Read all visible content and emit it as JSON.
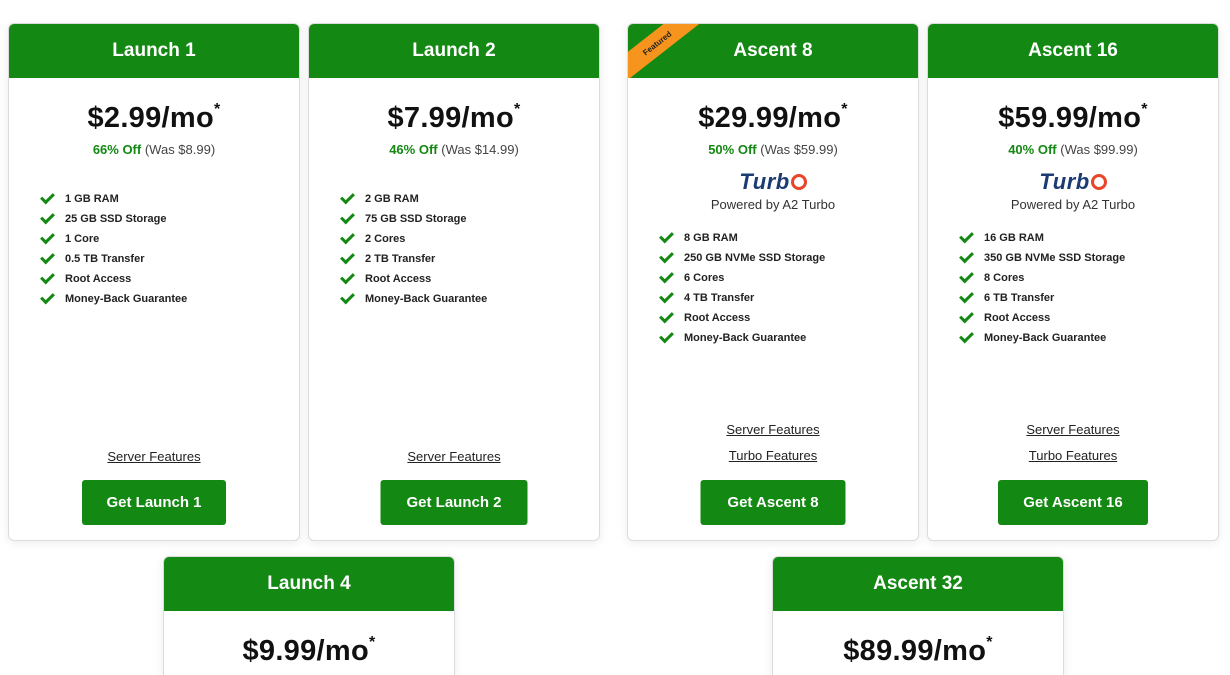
{
  "plans": [
    {
      "name": "Launch 1",
      "price": "$2.99/mo",
      "asterisk": "*",
      "off": "66% Off",
      "was": "(Was $8.99)",
      "features": [
        "1 GB RAM",
        "25 GB SSD Storage",
        "1 Core",
        "0.5 TB Transfer",
        "Root Access",
        "Money-Back Guarantee"
      ],
      "server_features": "Server Features",
      "cta": "Get Launch 1"
    },
    {
      "name": "Launch 2",
      "price": "$7.99/mo",
      "asterisk": "*",
      "off": "46% Off",
      "was": "(Was $14.99)",
      "features": [
        "2 GB RAM",
        "75 GB SSD Storage",
        "2 Cores",
        "2 TB Transfer",
        "Root Access",
        "Money-Back Guarantee"
      ],
      "server_features": "Server Features",
      "cta": "Get Launch 2"
    },
    {
      "name": "Ascent 8",
      "ribbon": "Featured",
      "price": "$29.99/mo",
      "asterisk": "*",
      "off": "50% Off",
      "was": "(Was $59.99)",
      "turbo_logo": "Turb",
      "turbo_sub": "Powered by A2 Turbo",
      "features": [
        "8 GB RAM",
        "250 GB NVMe SSD Storage",
        "6 Cores",
        "4 TB Transfer",
        "Root Access",
        "Money-Back Guarantee"
      ],
      "server_features": "Server Features",
      "turbo_features": "Turbo Features",
      "cta": "Get Ascent 8"
    },
    {
      "name": "Ascent 16",
      "price": "$59.99/mo",
      "asterisk": "*",
      "off": "40% Off",
      "was": "(Was $99.99)",
      "turbo_logo": "Turb",
      "turbo_sub": "Powered by A2 Turbo",
      "features": [
        "16 GB RAM",
        "350 GB NVMe SSD Storage",
        "8 Cores",
        "6 TB Transfer",
        "Root Access",
        "Money-Back Guarantee"
      ],
      "server_features": "Server Features",
      "turbo_features": "Turbo Features",
      "cta": "Get Ascent 16"
    },
    {
      "name": "Launch 4",
      "price": "$9.99/mo",
      "asterisk": "*"
    },
    {
      "name": "Ascent 32",
      "price": "$89.99/mo",
      "asterisk": "*"
    }
  ],
  "colors": {
    "brand_green": "#138812",
    "ribbon_orange": "#f7941d",
    "turbo_navy": "#1c3b73",
    "turbo_red": "#e8462a"
  }
}
